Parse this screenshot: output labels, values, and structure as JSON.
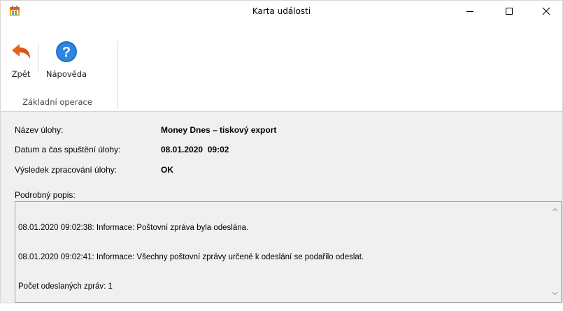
{
  "window": {
    "title": "Karta události",
    "icon": "calendar-app-icon"
  },
  "controls": {
    "minimize": "minimize-icon",
    "maximize": "maximize-icon",
    "close": "close-icon"
  },
  "ribbon": {
    "group_label": "Základní operace",
    "back_label": "Zpět",
    "help_label": "Nápověda",
    "colors": {
      "back_arrow": "#e8601c",
      "help_circle": "#1e6fc9"
    }
  },
  "details": {
    "task_name_label": "Název úlohy:",
    "task_name_value": "Money Dnes – tiskový export",
    "start_label": "Datum a čas spuštění úlohy:",
    "start_value": "08.01.2020  09:02",
    "result_label": "Výsledek zpracování úlohy:",
    "result_value": "OK",
    "description_label": "Podrobný popis:",
    "description_lines": [
      "08.01.2020 09:02:38: Informace: Poštovní zpráva byla odeslána.",
      "08.01.2020 09:02:41: Informace: Všechny poštovní zprávy určené k odeslání se podařilo odeslat.",
      "Počet odeslaných zpráv: 1"
    ]
  }
}
